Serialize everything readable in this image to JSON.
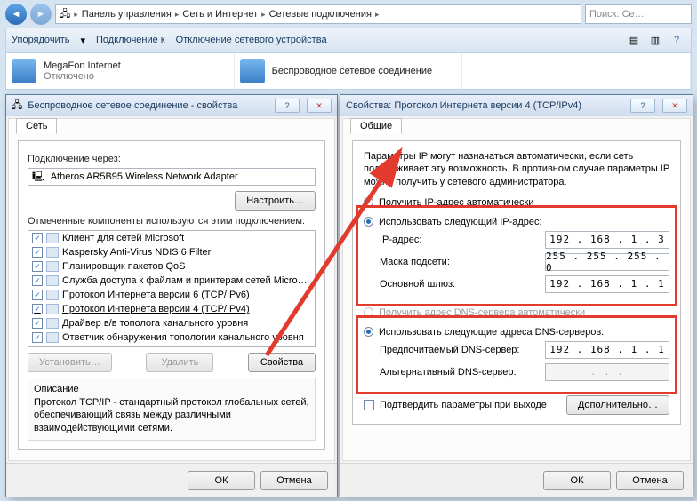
{
  "explorer": {
    "breadcrumbs": [
      "Панель управления",
      "Сеть и Интернет",
      "Сетевые подключения"
    ],
    "search_placeholder": "Поиск: Се…",
    "toolbar": {
      "organize": "Упорядочить",
      "connect": "Подключение к",
      "disable": "Отключение сетевого устройства"
    },
    "connections": [
      {
        "name": "MegaFon Internet",
        "status": "Отключено"
      },
      {
        "name": "Беспроводное сетевое соединение",
        "status": ""
      }
    ]
  },
  "dlg_props": {
    "title": "Беспроводное сетевое соединение - свойства",
    "tab": "Сеть",
    "connect_via": "Подключение через:",
    "adapter": "Atheros AR5B95 Wireless Network Adapter",
    "configure": "Настроить…",
    "components_label": "Отмеченные компоненты используются этим подключением:",
    "components": [
      "Клиент для сетей Microsoft",
      "Kaspersky Anti-Virus NDIS 6 Filter",
      "Планировщик пакетов QoS",
      "Служба доступа к файлам и принтерам сетей Micro…",
      "Протокол Интернета версии 6 (TCP/IPv6)",
      "Протокол Интернета версии 4 (TCP/IPv4)",
      "Драйвер в/в тополога канального уровня",
      "Ответчик обнаружения топологии канального уровня"
    ],
    "selected_index": 5,
    "btn_install": "Установить…",
    "btn_remove": "Удалить",
    "btn_properties": "Свойства",
    "desc_header": "Описание",
    "desc_text": "Протокол TCP/IP - стандартный протокол глобальных сетей, обеспечивающий связь между различными взаимодействующими сетями.",
    "ok": "ОК",
    "cancel": "Отмена"
  },
  "dlg_ipv4": {
    "title": "Свойства: Протокол Интернета версии 4 (TCP/IPv4)",
    "tab": "Общие",
    "intro": "Параметры IP могут назначаться автоматически, если сеть поддерживает эту возможность. В противном случае параметры IP можно получить у сетевого администратора.",
    "radio_auto_ip": "Получить IP-адрес автоматически",
    "radio_static_ip": "Использовать следующий IP-адрес:",
    "ip_label": "IP-адрес:",
    "ip_value": "192 . 168 .  1  .  3",
    "mask_label": "Маска подсети:",
    "mask_value": "255 . 255 . 255 .  0",
    "gw_label": "Основной шлюз:",
    "gw_value": "192 . 168 .  1  .  1",
    "radio_auto_dns": "Получить адрес DNS-сервера автоматически",
    "radio_static_dns": "Использовать следующие адреса DNS-серверов:",
    "dns1_label": "Предпочитаемый DNS-сервер:",
    "dns1_value": "192 . 168 .  1  .  1",
    "dns2_label": "Альтернативный DNS-сервер:",
    "dns2_value": " .     .     . ",
    "confirm_exit": "Подтвердить параметры при выходе",
    "advanced": "Дополнительно…",
    "ok": "ОК",
    "cancel": "Отмена"
  }
}
